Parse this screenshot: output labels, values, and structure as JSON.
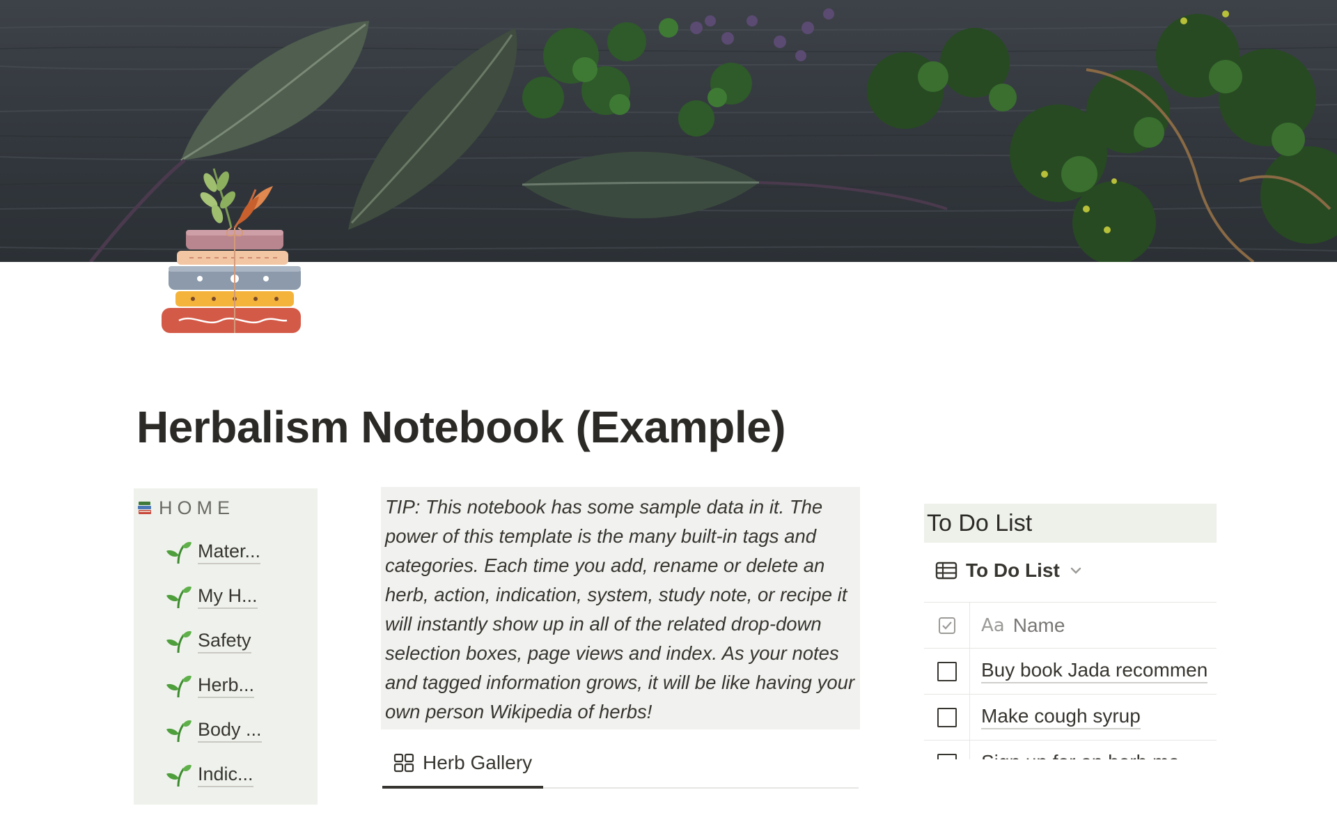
{
  "page": {
    "title": "Herbalism Notebook (Example)"
  },
  "cover": {
    "image_name": "herbs-on-wood-cover"
  },
  "icon": {
    "name": "books-with-herbs-icon"
  },
  "home": {
    "heading": "HOME",
    "items": [
      {
        "label": "Mater...",
        "icon": "sprout-icon"
      },
      {
        "label": "My H...",
        "icon": "sprout-icon"
      },
      {
        "label": "Safety",
        "icon": "sprout-icon"
      },
      {
        "label": "Herb...",
        "icon": "sprout-icon"
      },
      {
        "label": "Body ...",
        "icon": "sprout-icon"
      },
      {
        "label": "Indic...",
        "icon": "sprout-icon"
      }
    ]
  },
  "tip": {
    "text": "TIP: This notebook has some sample data in it. The power of this template is the many built-in tags and categories. Each time you add, rename or delete an herb, action, indication, system, study note, or recipe it will instantly show up in all of the related drop-down selection boxes, page views and index. As your notes and tagged information grows, it will be like having your own person Wikipedia of herbs!"
  },
  "gallery": {
    "tab_label": "Herb Gallery"
  },
  "todo": {
    "heading": "To Do List",
    "view_label": "To Do List",
    "columns": {
      "name_prefix": "Aa",
      "name": "Name"
    },
    "rows": [
      {
        "name": "Buy book Jada recommen",
        "checked": false
      },
      {
        "name": "Make cough syrup",
        "checked": false
      },
      {
        "name": "Sign up for an herb ma",
        "checked": false
      }
    ]
  },
  "colors": {
    "nav_background": "#eff2ec",
    "tip_background": "#f1f1ef",
    "todo_header_background": "#eef0ea",
    "text": "#37352f"
  }
}
